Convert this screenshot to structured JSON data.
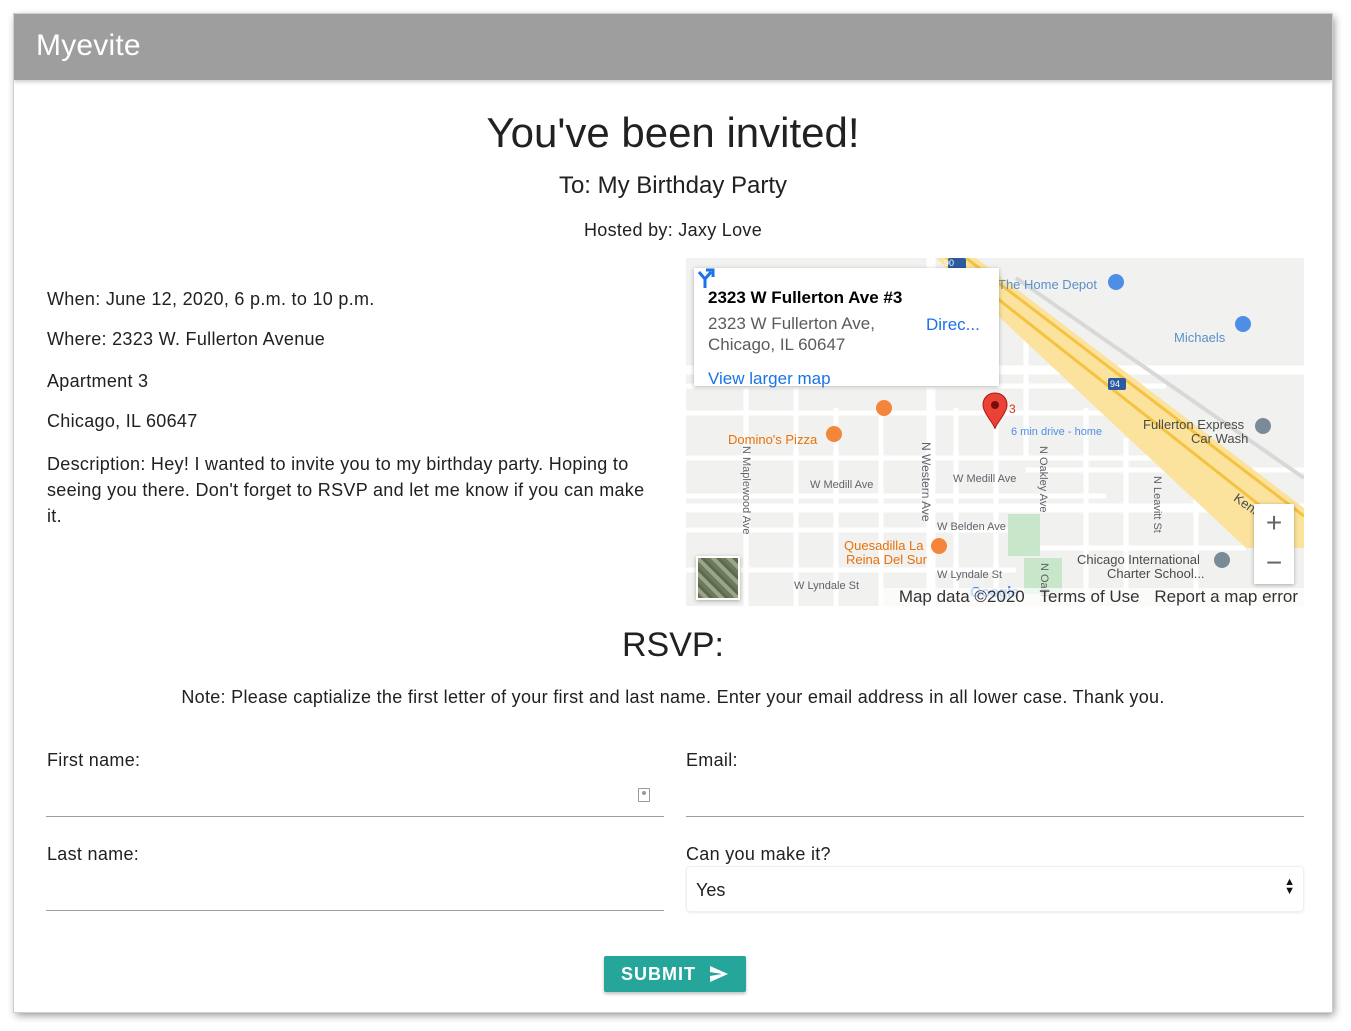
{
  "app": {
    "brand": "Myevite"
  },
  "invite": {
    "heading": "You've been invited!",
    "to": "To: My Birthday Party",
    "host": "Hosted by: Jaxy Love",
    "when": "When: June 12, 2020, 6 p.m. to 10 p.m.",
    "where": "Where: 2323 W. Fullerton Avenue",
    "apartment": "Apartment 3",
    "city": "Chicago, IL 60647",
    "description": "Description: Hey! I wanted to invite you to my birthday party. Hoping to seeing you there. Don't forget to RSVP and let me know if you can make it."
  },
  "map": {
    "card_title": "2323 W Fullerton Ave #3",
    "card_address_line1": "2323 W Fullerton Ave,",
    "card_address_line2": "Chicago, IL 60647",
    "directions": "Direc...",
    "view_larger": "View larger map",
    "zoom_in": "+",
    "zoom_out": "−",
    "logo": "Google",
    "footer_data": "Map data ©2020",
    "footer_terms": "Terms of Use",
    "footer_report": "Report a map error",
    "pin_label": "3",
    "pin_sub": "6 min drive - home",
    "poi": {
      "home_depot": "The Home Depot",
      "michaels": "Michaels",
      "fullerton_car_wash_1": "Fullerton Express",
      "fullerton_car_wash_2": "Car Wash",
      "dominos": "Domino's Pizza",
      "quesadilla_1": "Quesadilla La",
      "quesadilla_2": "Reina Del Sur",
      "chicago_intl_1": "Chicago International",
      "chicago_intl_2": "Charter School...",
      "kennedy": "Kenne"
    },
    "streets": {
      "w_medill_1": "W Medill Ave",
      "w_medill_2": "W Medill Ave",
      "w_belden": "W Belden Ave",
      "w_lyndale_1": "W Lyndale St",
      "w_lyndale_2": "W Lyndale St",
      "n_maplewood": "N Maplewood Ave",
      "n_western": "N Western Ave",
      "n_oakley": "N Oakley Ave",
      "n_leavitt": "N Leavitt St",
      "n_oakl": "N Oakl",
      "hwy_90": "90",
      "hwy_94": "94"
    }
  },
  "rsvp": {
    "heading": "RSVP:",
    "note": "Note: Please captialize the first letter of your first and last name. Enter your email address in all lower case. Thank you.",
    "first_name_label": "First name:",
    "first_name_value": "",
    "last_name_label": "Last name:",
    "last_name_value": "",
    "email_label": "Email:",
    "email_value": "",
    "attend_label": "Can you make it?",
    "attend_value": "Yes",
    "submit_label": "SUBMIT"
  },
  "colors": {
    "navbar": "#9e9e9e",
    "accent": "#26a69a",
    "link": "#1a73e8",
    "pin": "#ea4335"
  }
}
